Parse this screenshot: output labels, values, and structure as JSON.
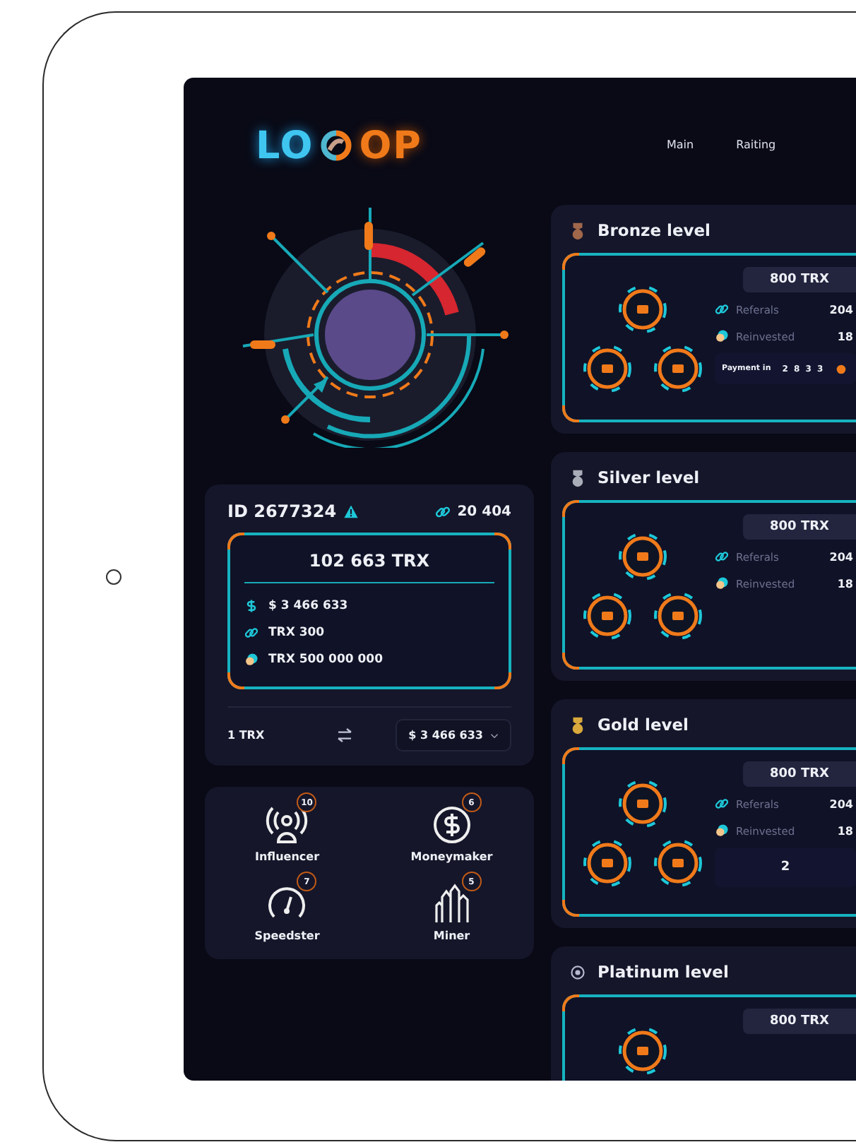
{
  "logo": {
    "left": "LO",
    "right": "OP"
  },
  "nav": [
    {
      "label": "Main"
    },
    {
      "label": "Raiting"
    }
  ],
  "profile": {
    "id": "ID 2677324",
    "referrals": "20 404",
    "balance": "102 663 TRX",
    "stats": [
      {
        "kind": "dollar",
        "text": "$ 3 466 633"
      },
      {
        "kind": "link",
        "text": "TRX 300"
      },
      {
        "kind": "coin",
        "text": "TRX 500 000 000"
      }
    ],
    "converter": {
      "from": "1 TRX",
      "to": "$ 3 466 633"
    }
  },
  "achievements": [
    {
      "kind": "broadcast",
      "name": "Influencer",
      "count": "10"
    },
    {
      "kind": "money",
      "name": "Moneymaker",
      "count": "6"
    },
    {
      "kind": "speed",
      "name": "Speedster",
      "count": "7"
    },
    {
      "kind": "crystal",
      "name": "Miner",
      "count": "5"
    }
  ],
  "levels": [
    {
      "title": "Bronze level",
      "kind": "medal",
      "color": "#a0674b",
      "price": "800 TRX",
      "referrals_label": "Referals",
      "referrals": "204",
      "reinvested_label": "Reinvested",
      "reinvested": "18",
      "footer": {
        "kind": "payment",
        "label": "Payment in",
        "value": "2 8 3 3"
      }
    },
    {
      "title": "Silver level",
      "kind": "medal",
      "color": "#a9adb8",
      "price": "800 TRX",
      "referrals_label": "Referals",
      "referrals": "204",
      "reinvested_label": "Reinvested",
      "reinvested": "18"
    },
    {
      "title": "Gold level",
      "kind": "medal",
      "color": "#d9a93c",
      "price": "800 TRX",
      "referrals_label": "Referals",
      "referrals": "204",
      "reinvested_label": "Reinvested",
      "reinvested": "18",
      "footer": {
        "kind": "counter",
        "value": "2"
      }
    },
    {
      "title": "Platinum level",
      "kind": "ring",
      "color": "#b7b9d0",
      "price": "800 TRX"
    }
  ]
}
